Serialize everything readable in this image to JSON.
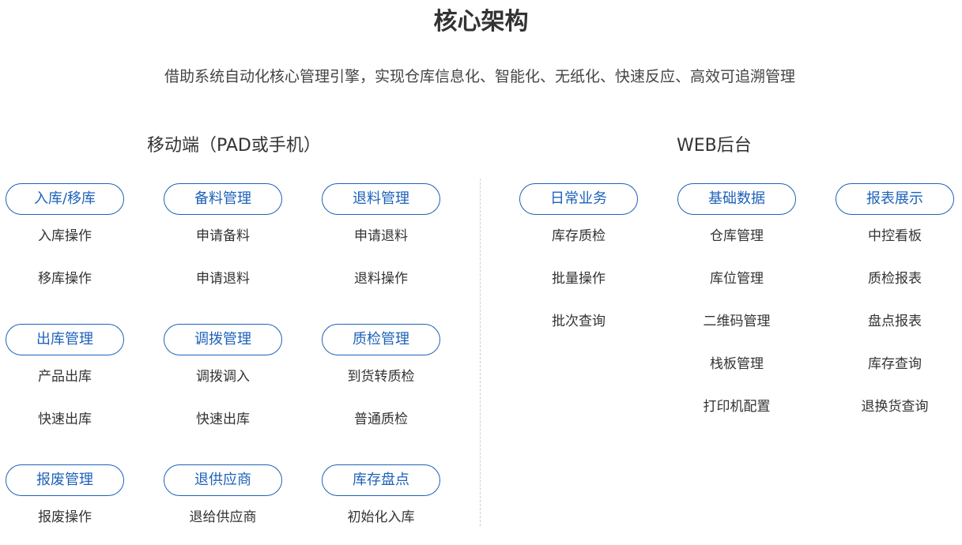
{
  "page": {
    "title": "核心架构",
    "subtitle": "借助系统自动化核心管理引擎，实现仓库信息化、智能化、无纸化、快速反应、高效可追溯管理"
  },
  "mobile": {
    "title": "移动端（PAD或手机）",
    "modules": [
      {
        "label": "入库/移库",
        "items": [
          "入库操作",
          "移库操作"
        ]
      },
      {
        "label": "备料管理",
        "items": [
          "申请备料",
          "申请退料"
        ]
      },
      {
        "label": "退料管理",
        "items": [
          "申请退料",
          "退料操作"
        ]
      },
      {
        "label": "出库管理",
        "items": [
          "产品出库",
          "快速出库"
        ]
      },
      {
        "label": "调拨管理",
        "items": [
          "调拨调入",
          "快速出库"
        ]
      },
      {
        "label": "质检管理",
        "items": [
          "到货转质检",
          "普通质检"
        ]
      },
      {
        "label": "报废管理",
        "items": [
          "报废操作"
        ]
      },
      {
        "label": "退供应商",
        "items": [
          "退给供应商"
        ]
      },
      {
        "label": "库存盘点",
        "items": [
          "初始化入库"
        ]
      }
    ]
  },
  "web": {
    "title": "WEB后台",
    "modules": [
      {
        "label": "日常业务",
        "items": [
          "库存质检",
          "批量操作",
          "批次查询"
        ]
      },
      {
        "label": "基础数据",
        "items": [
          "仓库管理",
          "库位管理",
          "二维码管理",
          "栈板管理",
          "打印机配置"
        ]
      },
      {
        "label": "报表展示",
        "items": [
          "中控看板",
          "质检报表",
          "盘点报表",
          "库存查询",
          "退换货查询"
        ]
      }
    ]
  },
  "colors": {
    "accent": "#1e62b8",
    "text": "#333333",
    "divider": "#cfcfcf"
  }
}
